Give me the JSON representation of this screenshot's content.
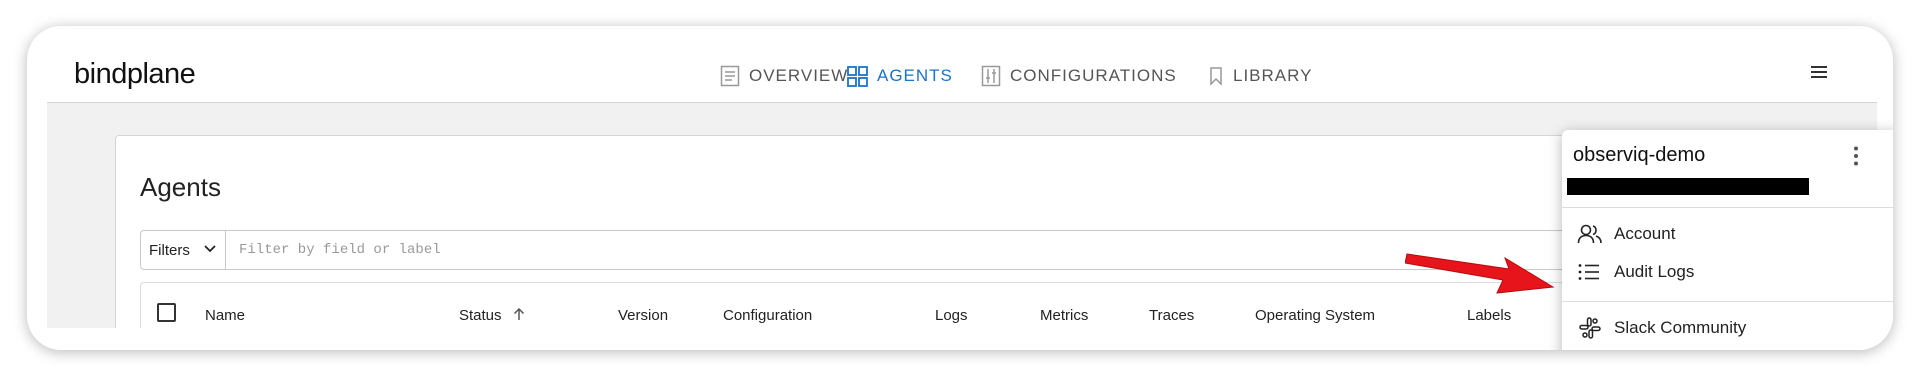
{
  "app": {
    "logo": "bindplane"
  },
  "nav": {
    "items": [
      {
        "label": "OVERVIEW",
        "icon": "document-icon",
        "active": false
      },
      {
        "label": "AGENTS",
        "icon": "grid-icon",
        "active": true
      },
      {
        "label": "CONFIGURATIONS",
        "icon": "sliders-icon",
        "active": false
      },
      {
        "label": "LIBRARY",
        "icon": "bookmark-icon",
        "active": false
      }
    ],
    "menu_icon": "hamburger-menu-icon"
  },
  "page": {
    "title": "Agents"
  },
  "filter": {
    "button_label": "Filters",
    "placeholder": "Filter by field or label"
  },
  "table": {
    "columns": [
      "Name",
      "Status",
      "Version",
      "Configuration",
      "Logs",
      "Metrics",
      "Traces",
      "Operating System",
      "Labels"
    ],
    "sorted_column": "Status",
    "sort_direction": "ascending"
  },
  "dropdown": {
    "org_name": "observiq-demo",
    "items": [
      {
        "label": "Account",
        "icon": "users-icon"
      },
      {
        "label": "Audit Logs",
        "icon": "list-icon"
      },
      {
        "label": "Slack Community",
        "icon": "slack-icon"
      }
    ]
  },
  "colors": {
    "accent": "#1a73c9",
    "annotation_arrow": "#e8141b"
  }
}
